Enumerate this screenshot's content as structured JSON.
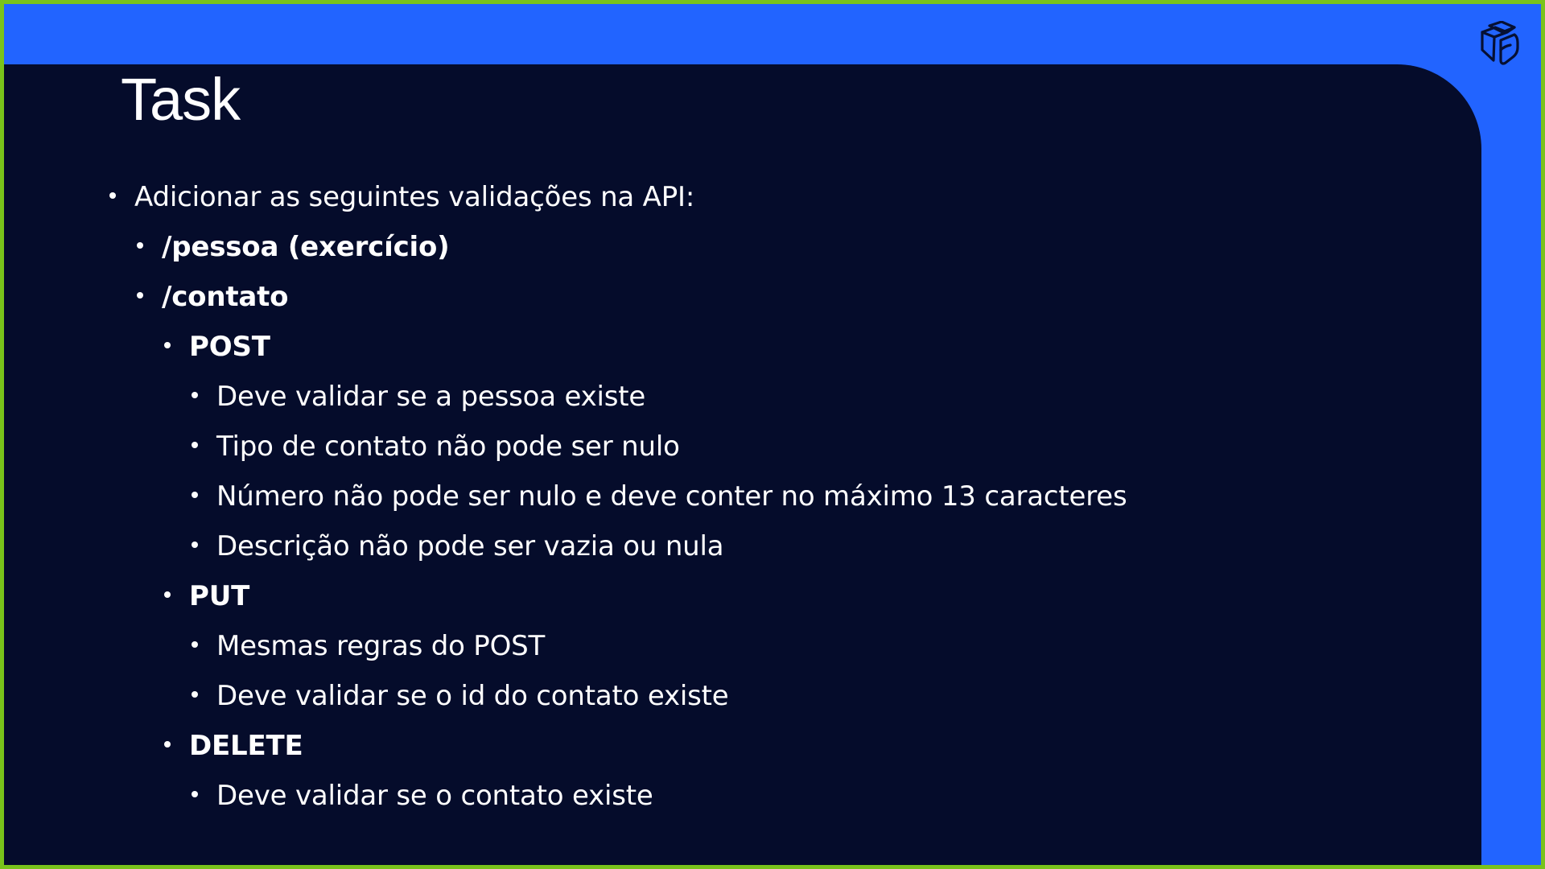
{
  "colors": {
    "header_blue": "#2264ff",
    "content_navy": "#050c2b",
    "frame_green": "#79c31b",
    "text": "#ffffff"
  },
  "logo": {
    "icon": "isometric-cube-logo"
  },
  "title": "Task",
  "bullets": [
    {
      "text": "Adicionar as seguintes validações na API:",
      "level": 0,
      "bold": false
    },
    {
      "text": "/pessoa (exercício)",
      "level": 1,
      "bold": true
    },
    {
      "text": "/contato",
      "level": 1,
      "bold": true
    },
    {
      "text": "POST",
      "level": 2,
      "bold": true
    },
    {
      "text": "Deve validar se a pessoa existe",
      "level": 3,
      "bold": false
    },
    {
      "text": "Tipo de contato não pode ser nulo",
      "level": 3,
      "bold": false
    },
    {
      "text": "Número não pode ser nulo e deve conter no máximo 13 caracteres",
      "level": 3,
      "bold": false
    },
    {
      "text": "Descrição não pode ser vazia ou nula",
      "level": 3,
      "bold": false
    },
    {
      "text": "PUT",
      "level": 2,
      "bold": true
    },
    {
      "text": "Mesmas regras do POST",
      "level": 3,
      "bold": false
    },
    {
      "text": "Deve validar se o id do contato existe",
      "level": 3,
      "bold": false
    },
    {
      "text": "DELETE",
      "level": 2,
      "bold": true
    },
    {
      "text": "Deve validar se o contato existe",
      "level": 3,
      "bold": false
    }
  ]
}
